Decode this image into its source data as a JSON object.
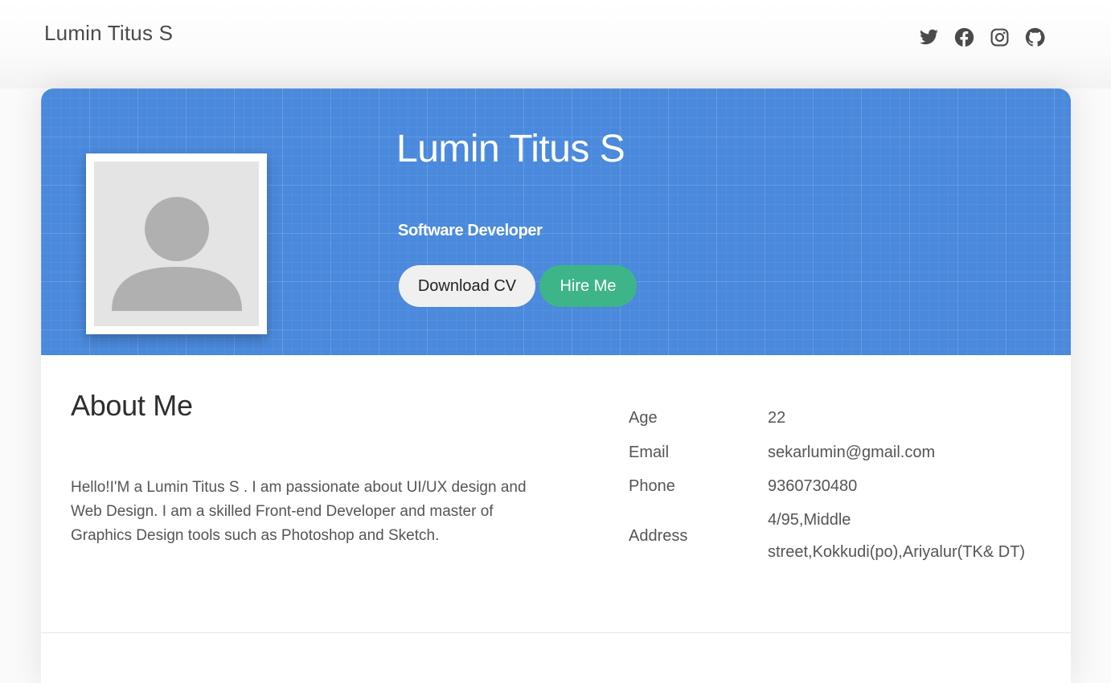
{
  "header": {
    "brand": "Lumin Titus S",
    "social_icons": [
      "twitter-icon",
      "facebook-icon",
      "instagram-icon",
      "github-icon"
    ]
  },
  "hero": {
    "name": "Lumin Titus S",
    "role": "Software Developer",
    "download_cv_label": "Download CV",
    "hire_me_label": "Hire Me",
    "avatar_icon": "user-placeholder-icon"
  },
  "about": {
    "title": "About Me",
    "paragraph_line1": "Hello!I'M a Lumin Titus S . I am passionate about UI/UX design and",
    "paragraph_line2": "Web Design. I am a skilled Front-end Developer and master of Graphics Design tools such as Photoshop and Sketch.",
    "info": {
      "age_label": "Age",
      "age_value": "22",
      "email_label": "Email",
      "email_value": "sekarlumin@gmail.com",
      "phone_label": "Phone",
      "phone_value": "9360730480",
      "address_label": "Address",
      "address_value": "4/95,Middle street,Kokkudi(po),Ariyalur(TK& DT)"
    }
  },
  "colors": {
    "hero_blue": "#4a89dc",
    "hire_green": "#3eb489",
    "cv_button": "#f0f0f0",
    "icon_gray": "#4a4a4a"
  }
}
